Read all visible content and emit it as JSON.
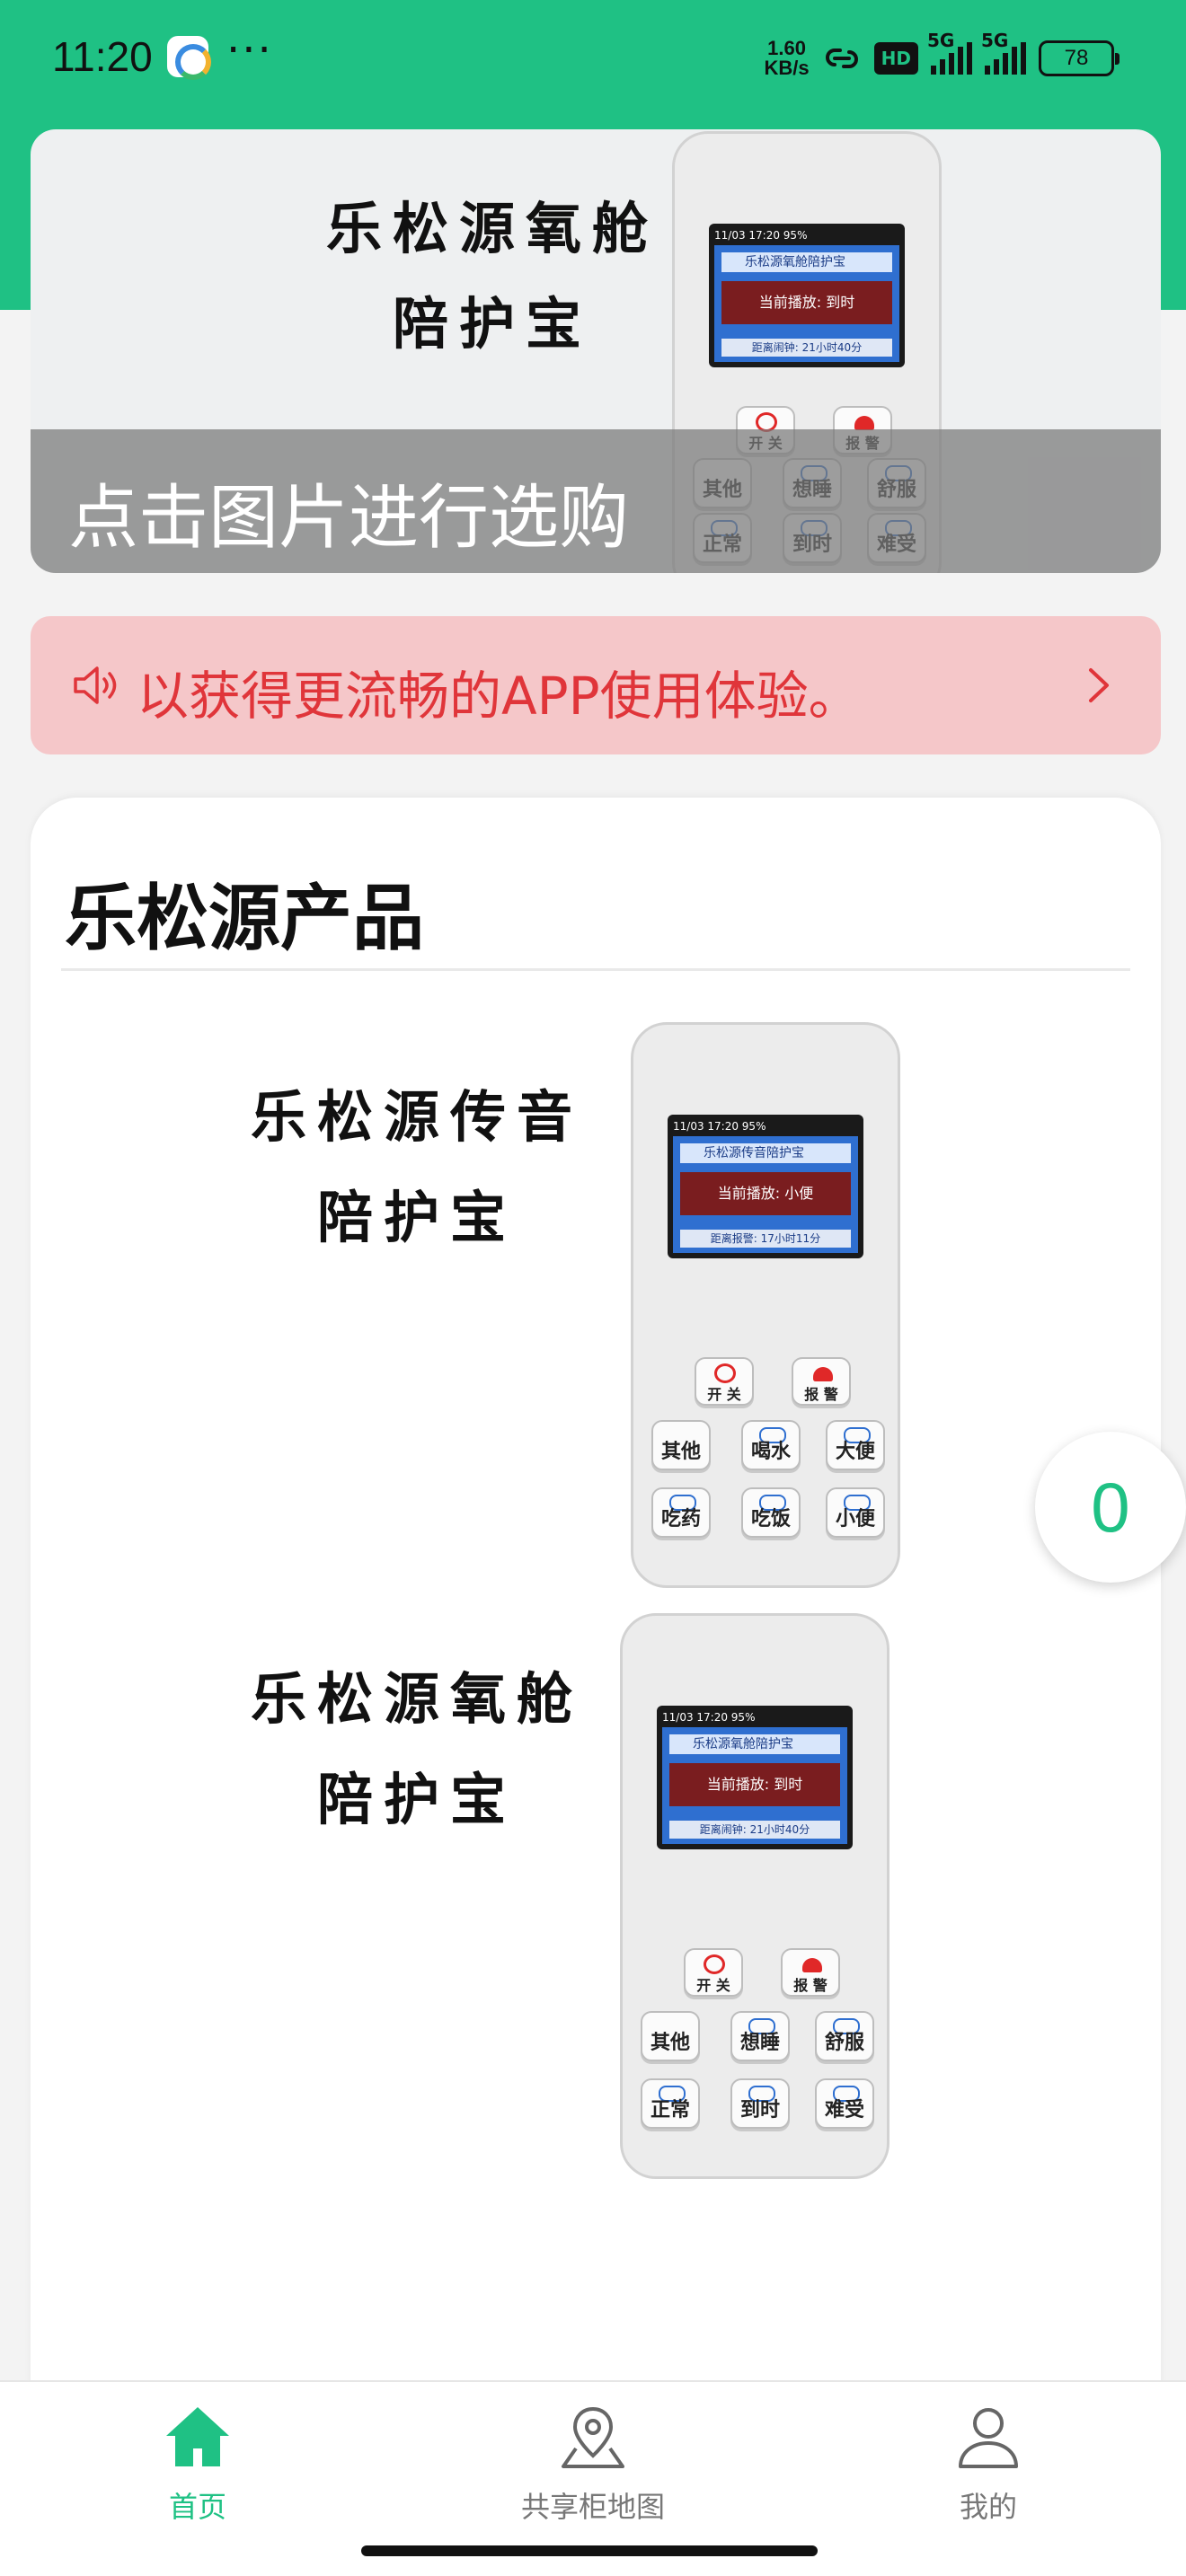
{
  "status_bar": {
    "time": "11:20",
    "more": "···",
    "net_speed_value": "1.60",
    "net_speed_unit": "KB/s",
    "hd_label": "HD",
    "signal_1_label": "5G",
    "signal_2_label": "5G",
    "battery": "78"
  },
  "banner": {
    "title_line1": "乐松源氧舱",
    "title_line2": "陪护宝",
    "caption": "点击图片进行选购"
  },
  "notice": {
    "text": "以获得更流畅的APP使用体验。"
  },
  "products_section": {
    "title": "乐松源产品",
    "items": [
      {
        "title_line1": "乐松源传音",
        "title_line2": "陪护宝",
        "device": {
          "status": "11/03 17:20  95%",
          "header": "乐松源传音陪护宝",
          "message": "当前播放: 小便",
          "footer": "距离报警: 17小时11分",
          "keys": [
            "开 关",
            "报 警",
            "其他",
            "喝水",
            "大便",
            "吃药",
            "吃饭",
            "小便"
          ]
        }
      },
      {
        "title_line1": "乐松源氧舱",
        "title_line2": "陪护宝",
        "device": {
          "status": "11/03 17:20  95%",
          "header": "乐松源氧舱陪护宝",
          "message": "当前播放: 到时",
          "footer": "距离闹钟: 21小时40分",
          "keys": [
            "开 关",
            "报 警",
            "其他",
            "想睡",
            "舒服",
            "正常",
            "到时",
            "难受"
          ]
        }
      }
    ]
  },
  "banner_device": {
    "status": "11/03 17:20  95%",
    "header": "乐松源氧舱陪护宝",
    "message": "当前播放: 到时",
    "footer": "距离闹钟: 21小时40分",
    "keys": [
      "开 关",
      "报 警",
      "其他",
      "想睡",
      "舒服",
      "正常",
      "到时",
      "难受"
    ]
  },
  "cart_fab": {
    "count": "0"
  },
  "tab_bar": {
    "tabs": [
      {
        "label": "首页",
        "icon": "home-icon",
        "active": true
      },
      {
        "label": "共享柜地图",
        "icon": "map-pin-icon",
        "active": false
      },
      {
        "label": "我的",
        "icon": "user-icon",
        "active": false
      }
    ]
  },
  "colors": {
    "brand_green": "#1fc184",
    "notice_bg": "#f5c7c9",
    "notice_text": "#e0353a"
  }
}
